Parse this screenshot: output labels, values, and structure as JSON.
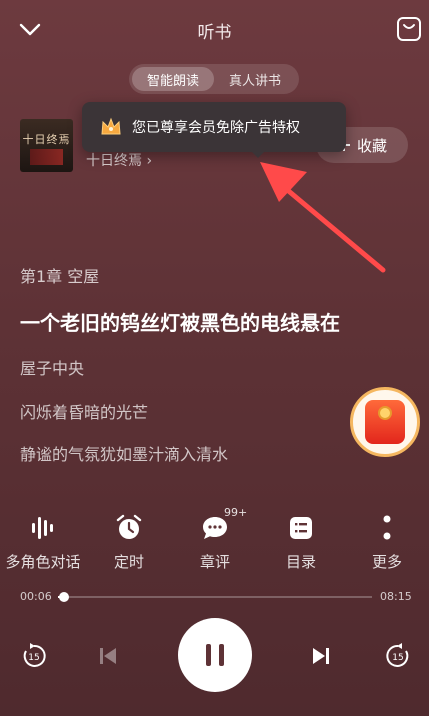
{
  "header": {
    "title": "听书",
    "back_icon": "chevron-down-icon",
    "bag_icon": "bag-icon"
  },
  "segment": {
    "tabs": [
      {
        "label": "智能朗读",
        "active": true
      },
      {
        "label": "真人讲书",
        "active": false
      }
    ]
  },
  "book": {
    "cover_text": "十日终焉",
    "title": "十日终焉 ›",
    "collect_label": "收藏"
  },
  "tooltip": {
    "text": "您已尊享会员免除广告特权",
    "icon": "crown-icon"
  },
  "content": {
    "chapter": "第1章 空屋",
    "lines": [
      {
        "text": "一个老旧的钨丝灯被黑色的电线悬在",
        "highlight": true
      },
      {
        "text": "屋子中央",
        "highlight": false
      },
      {
        "text": "闪烁着昏暗的光芒",
        "highlight": false
      },
      {
        "text": "静谧的气氛犹如墨汁滴入清水",
        "highlight": false
      }
    ]
  },
  "toolbar": {
    "items": [
      {
        "label": "多角色对话",
        "icon": "voice-wave-icon"
      },
      {
        "label": "定时",
        "icon": "alarm-clock-icon"
      },
      {
        "label": "章评",
        "icon": "comment-icon"
      },
      {
        "label": "目录",
        "icon": "catalog-icon"
      },
      {
        "label": "更多",
        "icon": "more-icon"
      }
    ],
    "comment_badge": "99+"
  },
  "progress": {
    "current": "00:06",
    "total": "08:15",
    "fraction": 0.012
  },
  "controls": {
    "rewind_label": "15",
    "forward_label": "15"
  },
  "colors": {
    "background": "#5e3236",
    "accent_red": "#ff4a4a"
  }
}
